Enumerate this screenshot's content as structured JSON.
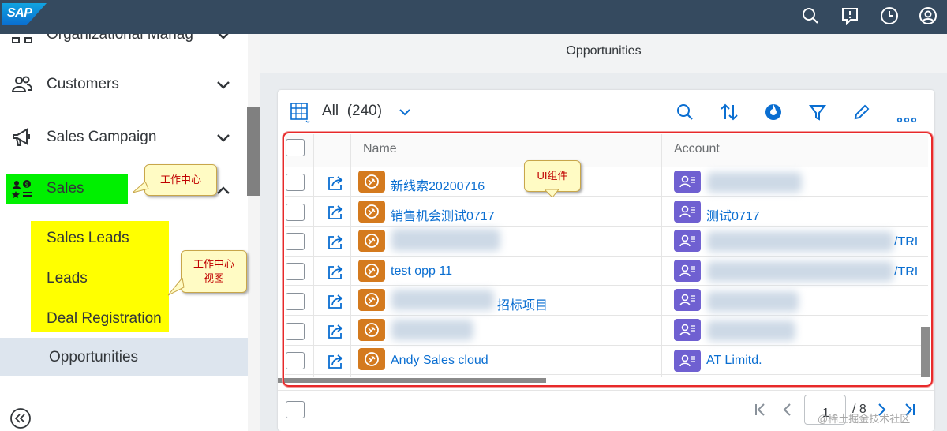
{
  "shell": {
    "logo_text": "SAP",
    "icons": [
      "search-icon",
      "feedback-icon",
      "clock-icon",
      "user-icon"
    ]
  },
  "nav": {
    "items": [
      {
        "label": "Organizational Manag",
        "icon": "org-icon"
      },
      {
        "label": "Customers",
        "icon": "customers-icon"
      },
      {
        "label": "Sales Campaign",
        "icon": "megaphone-icon"
      },
      {
        "label": "Sales",
        "icon": "sales-icon"
      }
    ],
    "sub_items": [
      {
        "label": "Sales Leads"
      },
      {
        "label": "Leads"
      },
      {
        "label": "Deal Registration"
      },
      {
        "label": "Opportunities"
      }
    ],
    "collapse_icon": "collapse-left-icon"
  },
  "callouts": {
    "work_center": "工作中心",
    "work_center_view_line1": "工作中心",
    "work_center_view_line2": "视图",
    "ui_component": "UI组件"
  },
  "page": {
    "title": "Opportunities"
  },
  "toolbar": {
    "view_label": "All",
    "count": "(240)",
    "icons": [
      "table-view-icon",
      "chevron-down-icon",
      "search-icon",
      "sort-icon",
      "chart-icon",
      "filter-icon",
      "edit-icon",
      "more-icon"
    ]
  },
  "table": {
    "columns": [
      "Name",
      "Account"
    ],
    "rows": [
      {
        "name": "新线索20200716",
        "account": ""
      },
      {
        "name": "销售机会测试0717",
        "account": "测试0717"
      },
      {
        "name": "",
        "account": "/TRI"
      },
      {
        "name": "test opp 11",
        "account": "/TRI"
      },
      {
        "name": "招标项目",
        "account": ""
      },
      {
        "name": "",
        "account": ""
      },
      {
        "name": "Andy Sales cloud",
        "account": "AT Limitd."
      }
    ]
  },
  "pagination": {
    "current_page": "1",
    "total": "/ 8"
  },
  "watermark": "@稀土掘金技术社区",
  "colors": {
    "shell": "#354a5f",
    "sales_highlight": "#00f000",
    "subnav_highlight": "#ffff00",
    "link": "#0a6ed1",
    "opportunity_icon": "#d47a1e",
    "account_icon": "#6f60d1",
    "frame": "#e8292a"
  }
}
